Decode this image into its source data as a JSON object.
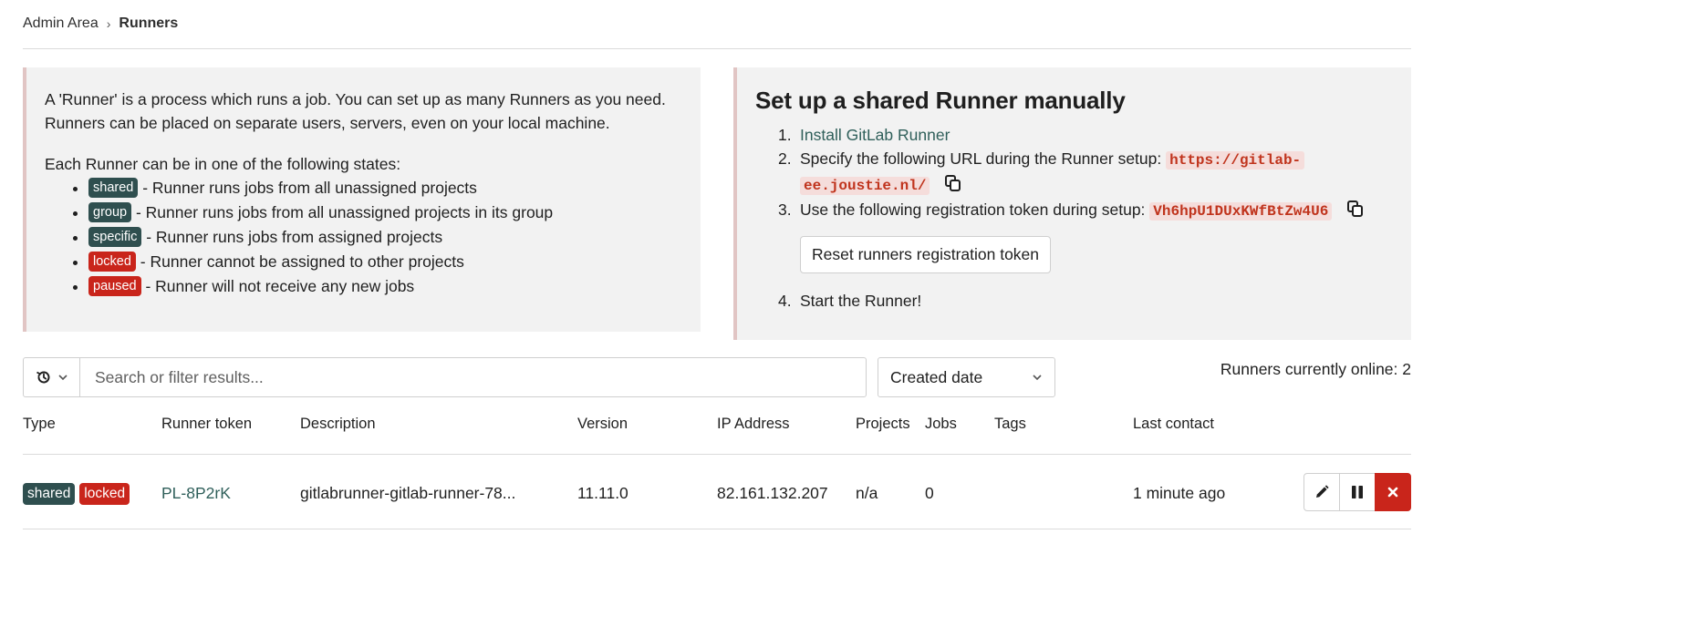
{
  "breadcrumb": {
    "parent": "Admin Area",
    "separator": "›",
    "current": "Runners"
  },
  "info_panel": {
    "intro": "A 'Runner' is a process which runs a job. You can set up as many Runners as you need. Runners can be placed on separate users, servers, even on your local machine.",
    "states_intro": "Each Runner can be in one of the following states:",
    "states": [
      {
        "badge": "shared",
        "text": "- Runner runs jobs from all unassigned projects",
        "color": "#2f4f4f"
      },
      {
        "badge": "group",
        "text": "- Runner runs jobs from all unassigned projects in its group",
        "color": "#2f4f4f"
      },
      {
        "badge": "specific",
        "text": "- Runner runs jobs from assigned projects",
        "color": "#2f4f4f"
      },
      {
        "badge": "locked",
        "text": "- Runner cannot be assigned to other projects",
        "color": "#c9251b"
      },
      {
        "badge": "paused",
        "text": "- Runner will not receive any new jobs",
        "color": "#c9251b"
      }
    ]
  },
  "setup_panel": {
    "title": "Set up a shared Runner manually",
    "steps": {
      "s1_num": "1.",
      "s1_link": "Install GitLab Runner",
      "s2_num": "2.",
      "s2_text": "Specify the following URL during the Runner setup:",
      "s2_url_line1": "https://gitlab-",
      "s2_url_line2": "ee.joustie.nl/",
      "s3_num": "3.",
      "s3_text": "Use the following registration token during setup:",
      "s3_token": "Vh6hpU1DUxKWfBtZw4U6",
      "reset_button": "Reset runners registration token",
      "s4_num": "4.",
      "s4_text": "Start the Runner!"
    },
    "icons": {
      "copy": "copy-icon"
    }
  },
  "filter": {
    "placeholder": "Search or filter results...",
    "history_icon": "history-icon",
    "sort_label": "Created date"
  },
  "online_count": "Runners currently online: 2",
  "table": {
    "headers": {
      "type": "Type",
      "token": "Runner token",
      "description": "Description",
      "version": "Version",
      "ip": "IP Address",
      "projects": "Projects",
      "jobs": "Jobs",
      "tags": "Tags",
      "last_contact": "Last contact"
    },
    "rows": [
      {
        "badges": [
          "shared",
          "locked"
        ],
        "token": "PL-8P2rK",
        "description": "gitlabrunner-gitlab-runner-78...",
        "version": "11.11.0",
        "ip": "82.161.132.207",
        "projects": "n/a",
        "jobs": "0",
        "tags": "",
        "last_contact": "1 minute ago"
      }
    ]
  },
  "colors": {
    "badge_dark": "#2f4f4f",
    "badge_red": "#c9251b",
    "link": "#2f5f5a",
    "code": "#c0341d"
  }
}
